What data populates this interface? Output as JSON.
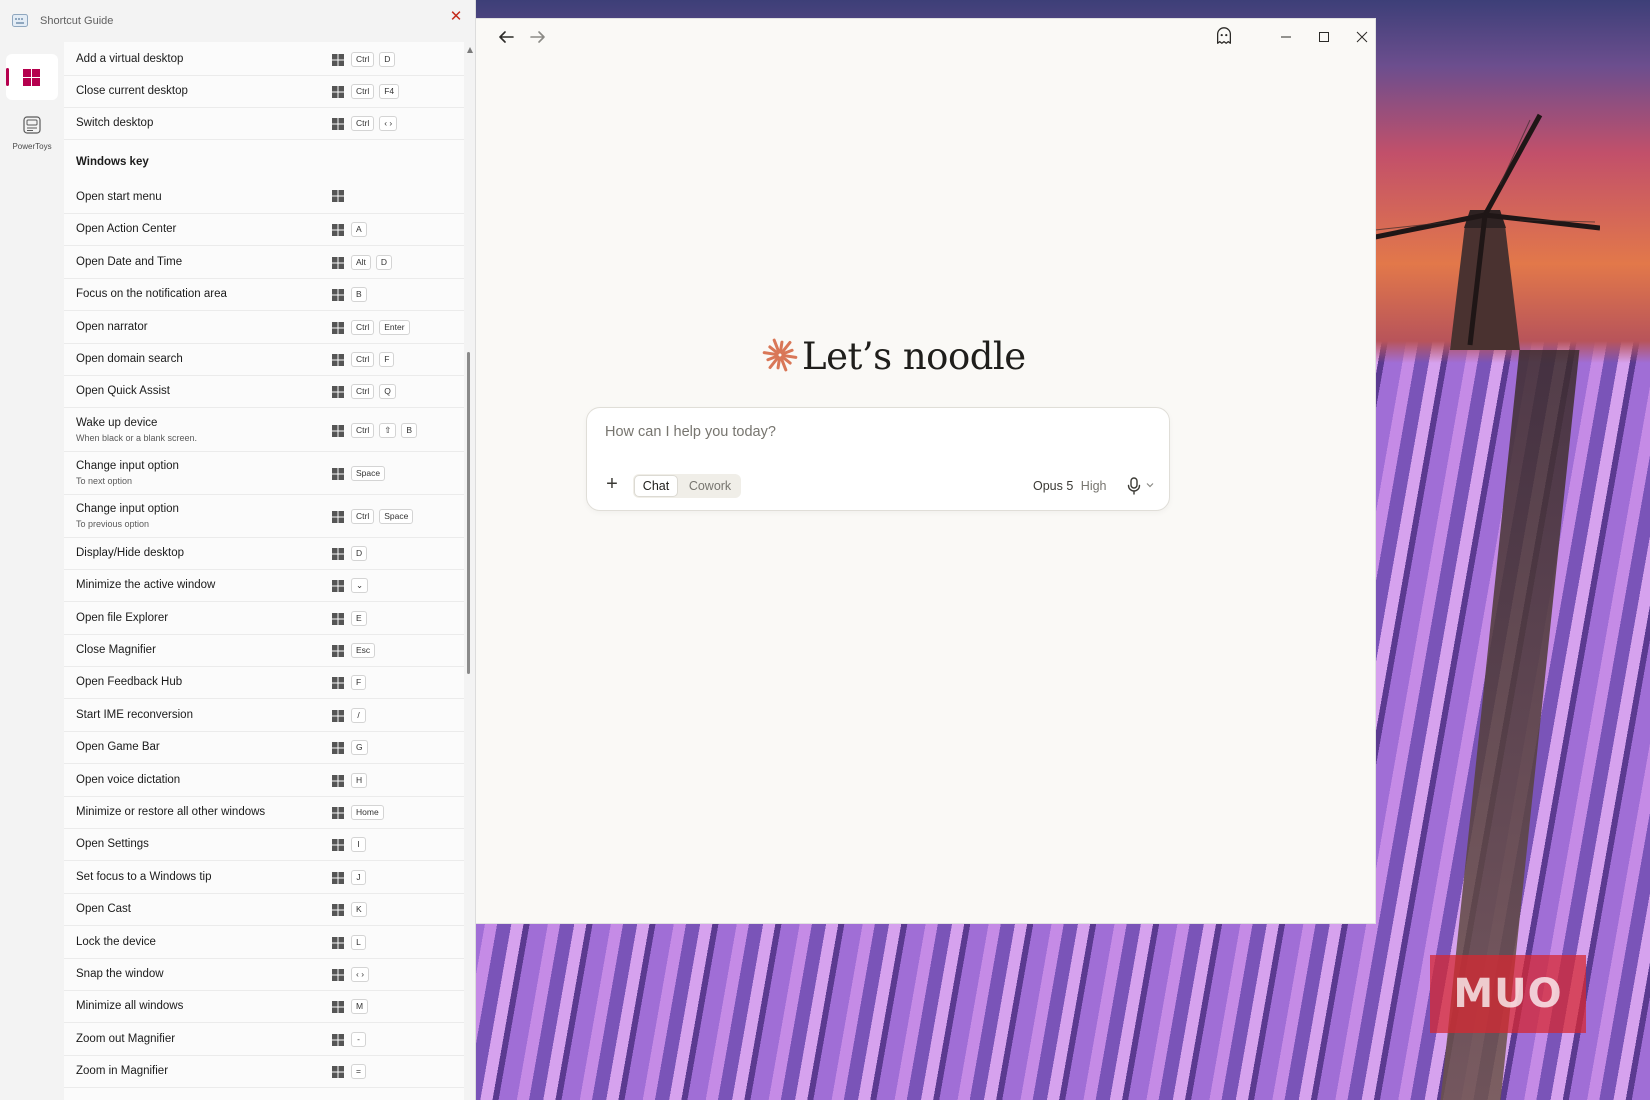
{
  "shortcut_guide": {
    "title": "Shortcut Guide",
    "nav": [
      {
        "id": "windows",
        "label": "",
        "icon": "windows-logo-icon",
        "selected": true
      },
      {
        "id": "powertoys",
        "label": "PowerToys",
        "icon": "powertoys-icon",
        "selected": false
      }
    ],
    "accent_color": "#b5004e",
    "close_color": "#c42b1c",
    "rows_top": [
      {
        "label": "Add a virtual desktop",
        "keys": [
          "Ctrl",
          "D"
        ]
      },
      {
        "label": "Close current desktop",
        "keys": [
          "Ctrl",
          "F4"
        ]
      },
      {
        "label": "Switch desktop",
        "keys": [
          "Ctrl",
          "‹ ›"
        ]
      }
    ],
    "section_title": "Windows key",
    "rows": [
      {
        "label": "Open start menu",
        "keys": []
      },
      {
        "label": "Open Action Center",
        "keys": [
          "A"
        ]
      },
      {
        "label": "Open Date and Time",
        "keys": [
          "Alt",
          "D"
        ]
      },
      {
        "label": "Focus on the notification area",
        "keys": [
          "B"
        ]
      },
      {
        "label": "Open narrator",
        "keys": [
          "Ctrl",
          "Enter"
        ]
      },
      {
        "label": "Open domain search",
        "keys": [
          "Ctrl",
          "F"
        ]
      },
      {
        "label": "Open Quick Assist",
        "keys": [
          "Ctrl",
          "Q"
        ]
      },
      {
        "label": "Wake up device",
        "sub": "When black or a blank screen.",
        "keys": [
          "Ctrl",
          "⇧",
          "B"
        ]
      },
      {
        "label": "Change input option",
        "sub": "To next option",
        "keys": [
          "Space"
        ]
      },
      {
        "label": "Change input option",
        "sub": "To previous option",
        "keys": [
          "Ctrl",
          "Space"
        ]
      },
      {
        "label": "Display/Hide desktop",
        "keys": [
          "D"
        ]
      },
      {
        "label": "Minimize the active window",
        "keys": [
          "⌄"
        ]
      },
      {
        "label": "Open file Explorer",
        "keys": [
          "E"
        ]
      },
      {
        "label": "Close Magnifier",
        "keys": [
          "Esc"
        ]
      },
      {
        "label": "Open Feedback Hub",
        "keys": [
          "F"
        ]
      },
      {
        "label": "Start IME reconversion",
        "keys": [
          "/"
        ]
      },
      {
        "label": "Open Game Bar",
        "keys": [
          "G"
        ]
      },
      {
        "label": "Open voice dictation",
        "keys": [
          "H"
        ]
      },
      {
        "label": "Minimize or restore all other windows",
        "keys": [
          "Home"
        ]
      },
      {
        "label": "Open Settings",
        "keys": [
          "I"
        ]
      },
      {
        "label": "Set focus to a Windows tip",
        "keys": [
          "J"
        ]
      },
      {
        "label": "Open Cast",
        "keys": [
          "K"
        ]
      },
      {
        "label": "Lock the device",
        "keys": [
          "L"
        ]
      },
      {
        "label": "Snap the window",
        "keys": [
          "‹ ›"
        ]
      },
      {
        "label": "Minimize all windows",
        "keys": [
          "M"
        ]
      },
      {
        "label": "Zoom out Magnifier",
        "keys": [
          "-"
        ]
      },
      {
        "label": "Zoom in Magnifier",
        "keys": [
          "="
        ]
      }
    ]
  },
  "claude": {
    "titlebar_icons": [
      "back-arrow-icon",
      "forward-arrow-icon",
      "ghost-icon",
      "minimize-icon",
      "maximize-icon",
      "close-icon"
    ],
    "greeting": "Let’s noodle",
    "asterisk_color": "#d97757",
    "composer": {
      "placeholder": "How can I help you today?",
      "modes": [
        "Chat",
        "Cowork"
      ],
      "active_mode": "Chat",
      "model": "Opus 5",
      "effort": "High"
    }
  },
  "watermark": "MUO"
}
